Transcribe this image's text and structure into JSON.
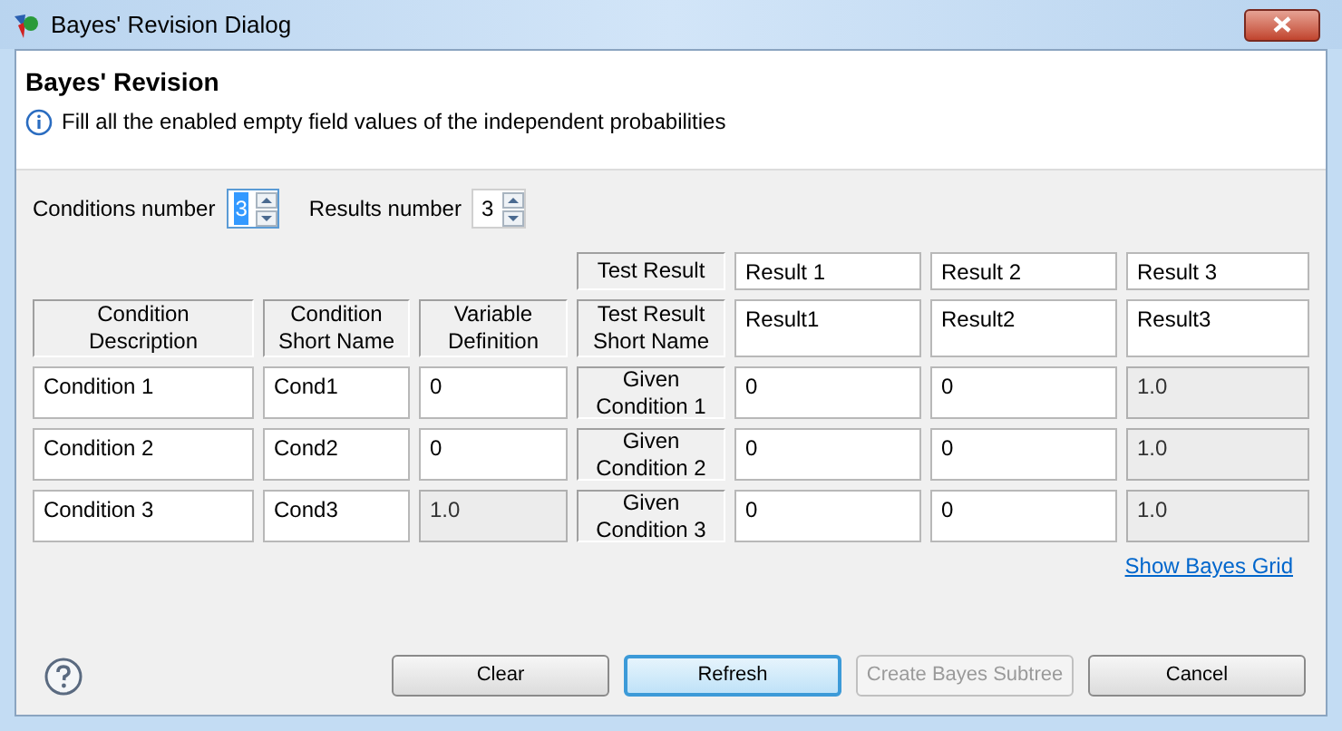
{
  "window": {
    "title": "Bayes' Revision Dialog"
  },
  "header": {
    "title": "Bayes' Revision",
    "message": "Fill all the enabled empty field values of the independent probabilities"
  },
  "spinners": [
    {
      "label": "Conditions number",
      "value": "3",
      "selected": true
    },
    {
      "label": "Results number",
      "value": "3",
      "selected": false
    }
  ],
  "table": {
    "column_headers": [
      "Condition Description",
      "Condition Short Name",
      "Variable Definition"
    ],
    "test_result_label": "Test Result",
    "test_result_short_label": "Test Result Short Name",
    "results": [
      {
        "name": "Result 1",
        "short_name": "Result1"
      },
      {
        "name": "Result 2",
        "short_name": "Result2"
      },
      {
        "name": "Result 3",
        "short_name": "Result3"
      }
    ],
    "rows": [
      {
        "description": "Condition 1",
        "short_name": "Cond1",
        "variable": {
          "value": "0",
          "disabled": false
        },
        "given_label": "Given Condition 1",
        "cells": [
          {
            "value": "0",
            "disabled": false
          },
          {
            "value": "0",
            "disabled": false
          },
          {
            "value": "1.0",
            "disabled": true
          }
        ]
      },
      {
        "description": "Condition 2",
        "short_name": "Cond2",
        "variable": {
          "value": "0",
          "disabled": false
        },
        "given_label": "Given Condition 2",
        "cells": [
          {
            "value": "0",
            "disabled": false
          },
          {
            "value": "0",
            "disabled": false
          },
          {
            "value": "1.0",
            "disabled": true
          }
        ]
      },
      {
        "description": "Condition 3",
        "short_name": "Cond3",
        "variable": {
          "value": "1.0",
          "disabled": true
        },
        "given_label": "Given Condition 3",
        "cells": [
          {
            "value": "0",
            "disabled": false
          },
          {
            "value": "0",
            "disabled": false
          },
          {
            "value": "1.0",
            "disabled": true
          }
        ]
      }
    ]
  },
  "link": "Show Bayes Grid",
  "buttons": [
    {
      "label": "Clear",
      "kind": "normal",
      "disabled": false
    },
    {
      "label": "Refresh",
      "kind": "default",
      "disabled": false
    },
    {
      "label": "Create Bayes Subtree",
      "kind": "normal",
      "disabled": true
    },
    {
      "label": "Cancel",
      "kind": "normal",
      "disabled": false
    }
  ]
}
